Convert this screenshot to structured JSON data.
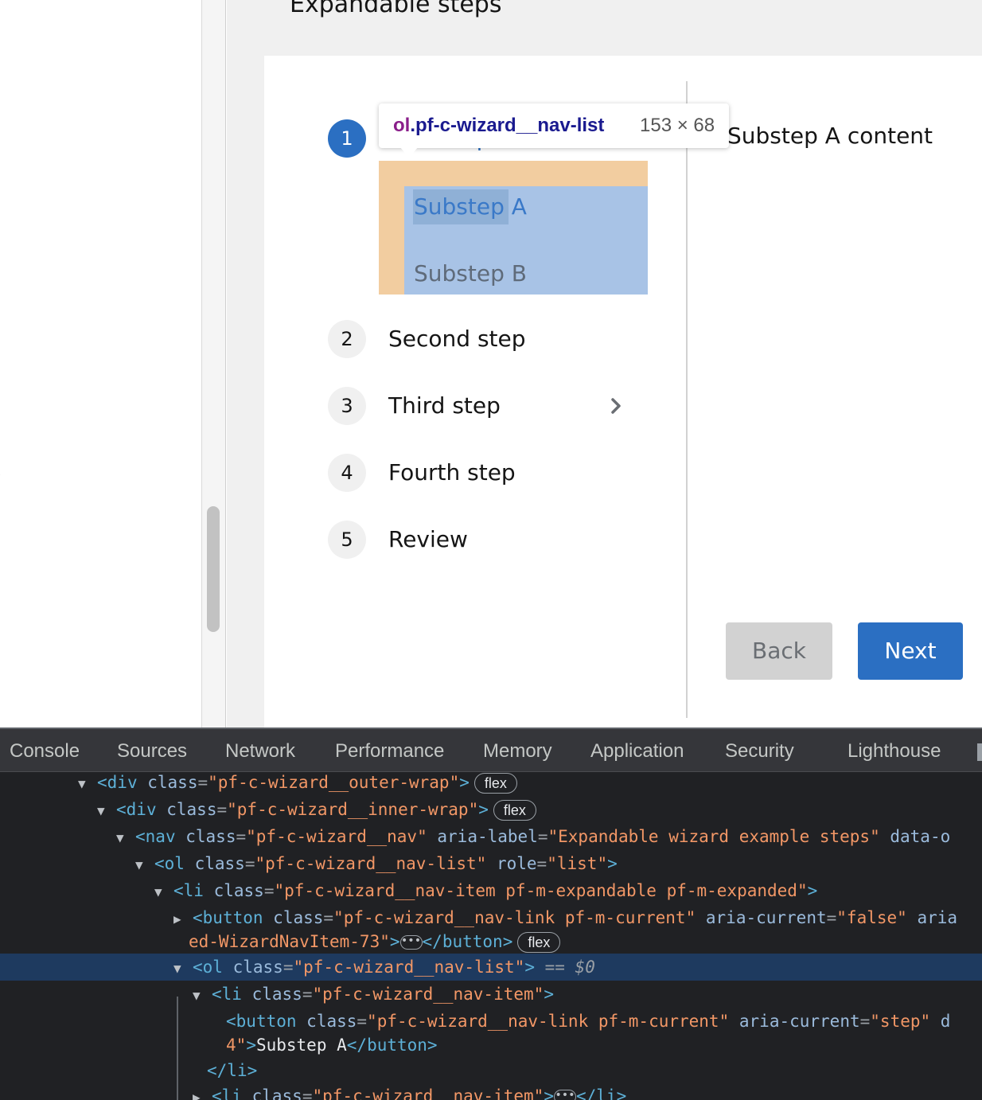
{
  "page": {
    "section_title": "Expandable steps",
    "left_caret": "›",
    "wizard": {
      "steps": [
        {
          "number": "1",
          "label": "First step",
          "current": true
        },
        {
          "number": "2",
          "label": "Second step"
        },
        {
          "number": "3",
          "label": "Third step",
          "has_chevron": true
        },
        {
          "number": "4",
          "label": "Fourth step"
        },
        {
          "number": "5",
          "label": "Review"
        }
      ],
      "substeps": [
        "Substep A",
        "Substep B"
      ],
      "body_text": "Substep A content",
      "back_label": "Back",
      "next_label": "Next"
    },
    "tooltip": {
      "tag": "ol",
      "class": ".pf-c-wizard__nav-list",
      "dims": "153 × 68"
    },
    "colors": {
      "accent": "#2b6fc2",
      "highlight_margin": "#f2cda0",
      "highlight_content": "#a8c3e6"
    }
  },
  "devtools": {
    "tabs": [
      "Console",
      "Sources",
      "Network",
      "Performance",
      "Memory",
      "Application",
      "Security",
      "Lighthouse"
    ],
    "dom": {
      "r1": {
        "tag": "div",
        "attr": "class",
        "val": "pf-c-wizard__outer-wrap",
        "badge": "flex"
      },
      "r2": {
        "tag": "div",
        "attr": "class",
        "val": "pf-c-wizard__inner-wrap",
        "badge": "flex"
      },
      "r3": {
        "tag": "nav",
        "attr": "class",
        "val": "pf-c-wizard__nav",
        "attr2": "aria-label",
        "val2": "Expandable wizard example steps",
        "trail": " data-o"
      },
      "r4": {
        "tag": "ol",
        "attr": "class",
        "val": "pf-c-wizard__nav-list",
        "attr2": "role",
        "val2": "list"
      },
      "r5": {
        "tag": "li",
        "attr": "class",
        "val": "pf-c-wizard__nav-item pf-m-expandable pf-m-expanded"
      },
      "r6": {
        "tag": "button",
        "attr": "class",
        "val": "pf-c-wizard__nav-link pf-m-current",
        "attr2": "aria-current",
        "val2": "false",
        "trail": " aria"
      },
      "r7": {
        "text": "ed-WizardNavItem-73",
        "close": "button",
        "badge": "flex"
      },
      "r8": {
        "tag": "ol",
        "attr": "class",
        "val": "pf-c-wizard__nav-list",
        "suffix": "== $0"
      },
      "r9": {
        "tag": "li",
        "attr": "class",
        "val": "pf-c-wizard__nav-item"
      },
      "r10": {
        "tag": "button",
        "attr": "class",
        "val": "pf-c-wizard__nav-link pf-m-current",
        "attr2": "aria-current",
        "val2": "step",
        "trail": " d"
      },
      "r11": {
        "text": "4",
        "inner": "Substep A",
        "close": "button"
      },
      "r12": {
        "close": "li"
      },
      "r13": {
        "tag": "li",
        "attr": "class",
        "val": "pf-c-wizard__nav-item",
        "close": "li"
      }
    }
  }
}
